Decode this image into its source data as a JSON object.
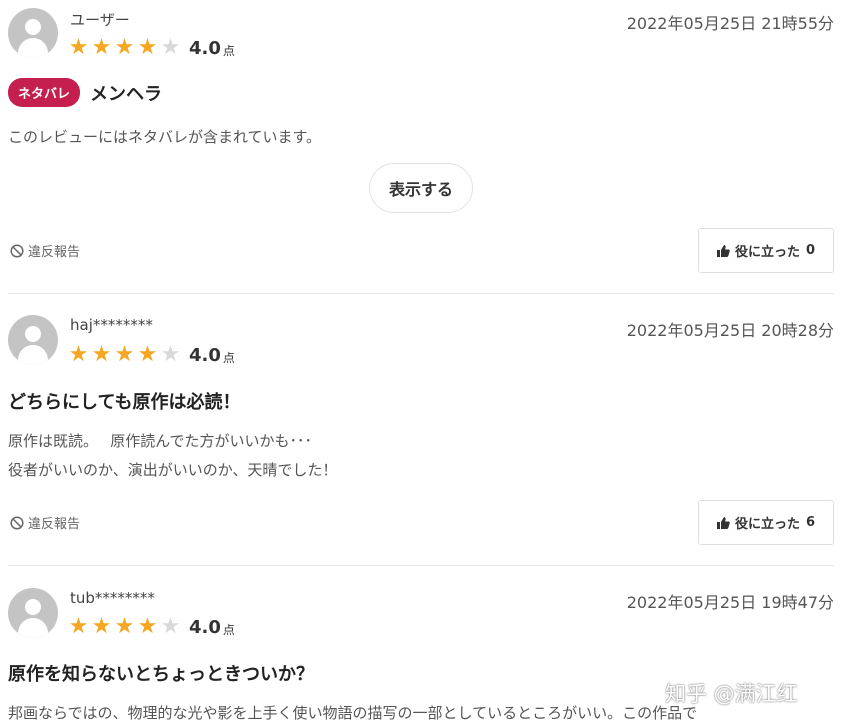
{
  "reviews": [
    {
      "username": "ユーザー",
      "rating": 4,
      "score": "4.0",
      "score_unit": "点",
      "date": "2022年05月25日 21時55分",
      "spoiler_tag": "ネタバレ",
      "title": "メンヘラ",
      "body": [
        "このレビューにはネタバレが含まれています。"
      ],
      "show_button": "表示する",
      "report_label": "違反報告",
      "helpful_label": "役に立った",
      "helpful_count": "0"
    },
    {
      "username": "haj********",
      "rating": 4,
      "score": "4.0",
      "score_unit": "点",
      "date": "2022年05月25日 20時28分",
      "title": "どちらにしても原作は必読！",
      "body": [
        "原作は既読。　 原作読んでた方がいいかも･･･",
        "役者がいいのか、演出がいいのか、天晴でした！"
      ],
      "report_label": "違反報告",
      "helpful_label": "役に立った",
      "helpful_count": "6"
    },
    {
      "username": "tub********",
      "rating": 4,
      "score": "4.0",
      "score_unit": "点",
      "date": "2022年05月25日 19時47分",
      "title": "原作を知らないとちょっときついか？",
      "body": [
        "邦画ならではの、物理的な光や影を上手く使い物語の描写の一部としているところがいい。この作品で"
      ]
    }
  ],
  "watermark": "知乎 @满江红",
  "colors": {
    "star": "#f5a623",
    "spoiler_tag": "#c41f4f"
  },
  "icons": {
    "avatar": "user-silhouette-icon",
    "report": "prohibited-icon",
    "helpful": "thumbs-up-icon"
  }
}
